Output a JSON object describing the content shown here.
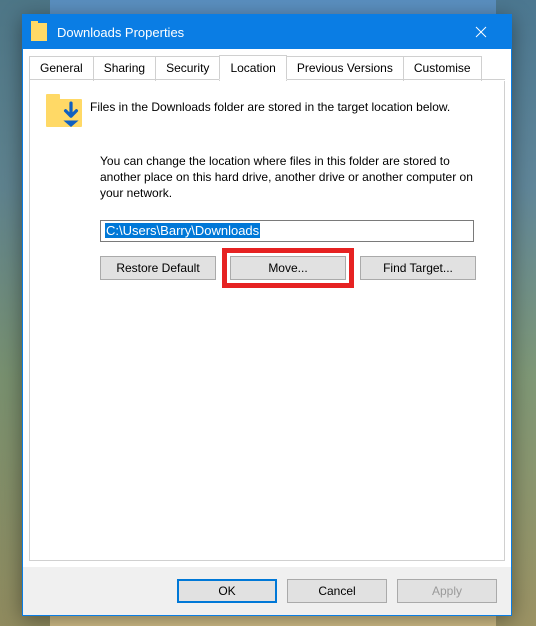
{
  "colors": {
    "accent": "#0a7de4",
    "highlight": "#e62222"
  },
  "titlebar": {
    "title": "Downloads Properties"
  },
  "tabs": {
    "items": [
      {
        "label": "General"
      },
      {
        "label": "Sharing"
      },
      {
        "label": "Security"
      },
      {
        "label": "Location"
      },
      {
        "label": "Previous Versions"
      },
      {
        "label": "Customise"
      }
    ],
    "active_index": 3
  },
  "location_tab": {
    "intro": "Files in the Downloads folder are stored in the target location below.",
    "description": "You can change the location where files in this folder are stored to another place on this hard drive, another drive or another computer on your network.",
    "path_value": "C:\\Users\\Barry\\Downloads",
    "buttons": {
      "restore": "Restore Default",
      "move": "Move...",
      "find": "Find Target..."
    }
  },
  "dialog_buttons": {
    "ok": "OK",
    "cancel": "Cancel",
    "apply": "Apply"
  }
}
